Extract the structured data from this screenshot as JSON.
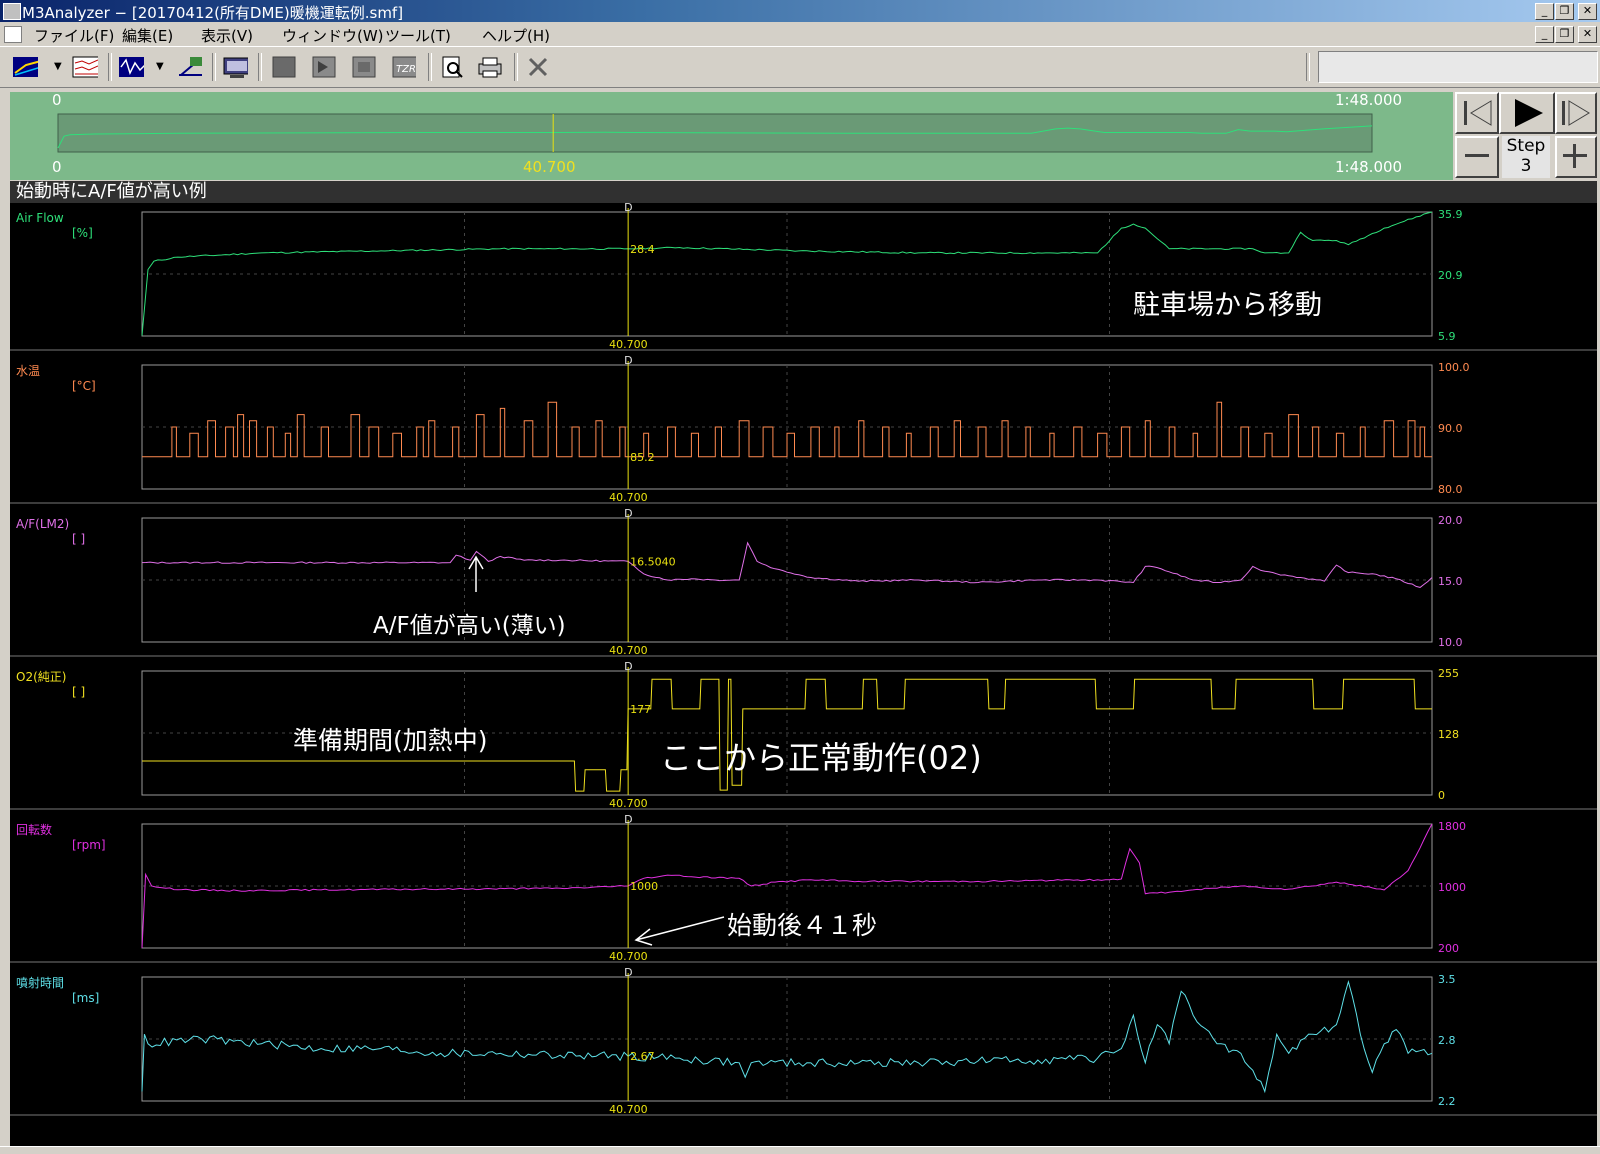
{
  "window": {
    "title": "M3Analyzer − [20170412(所有DME)暖機運転例.smf]"
  },
  "menu": [
    "ファイル(F)",
    "編集(E)",
    "表示(V)",
    "ウィンドウ(W)",
    "ツール(T)",
    "ヘルプ(H)"
  ],
  "overview": {
    "start": "0",
    "end": "1:48.000",
    "cursor": "40.700",
    "start_bottom": "0",
    "end_bottom": "1:48.000"
  },
  "controls": {
    "step_label": "Step",
    "step_value": "3"
  },
  "chart_window": {
    "title": "始動時にA/F値が高い例"
  },
  "chart_data": [
    {
      "type": "line",
      "name": "Air Flow",
      "unit": "[%]",
      "color": "#2ee07a",
      "ylim": [
        5.9,
        35.9
      ],
      "yticks": [
        "35.9",
        "20.9",
        "5.9"
      ],
      "cursor_value": "28.4",
      "cursor_time": "40.700",
      "x": [
        0,
        0.5,
        1,
        3,
        10,
        20,
        30,
        40.7,
        45,
        55,
        65,
        75,
        80,
        82,
        83,
        84,
        86,
        90,
        93,
        94,
        96,
        97,
        98,
        100,
        101,
        104,
        108
      ],
      "y": [
        6,
        22,
        24,
        25,
        26,
        26.5,
        27,
        27,
        27.3,
        26.5,
        26,
        26,
        26,
        32,
        33,
        32,
        27,
        27,
        27,
        26,
        26,
        31,
        29,
        29,
        28,
        32,
        36
      ]
    },
    {
      "type": "line",
      "name": "水温",
      "unit": "[°C]",
      "color": "#ff8a50",
      "ylim": [
        80.0,
        100.0
      ],
      "yticks": [
        "100.0",
        "90.0",
        "80.0"
      ],
      "cursor_value": "85.2",
      "cursor_time": "40.700",
      "base": 85.2,
      "spikes": [
        [
          2.5,
          90
        ],
        [
          4,
          89
        ],
        [
          5.5,
          91
        ],
        [
          7,
          90
        ],
        [
          8,
          92
        ],
        [
          9,
          91
        ],
        [
          10.5,
          90
        ],
        [
          12,
          89
        ],
        [
          13,
          92
        ],
        [
          15,
          90
        ],
        [
          17.5,
          92
        ],
        [
          19,
          90
        ],
        [
          21,
          89
        ],
        [
          23,
          90
        ],
        [
          24,
          91
        ],
        [
          26,
          90
        ],
        [
          28,
          92
        ],
        [
          30,
          93
        ],
        [
          32,
          91
        ],
        [
          34,
          94
        ],
        [
          36,
          90
        ],
        [
          38,
          91
        ],
        [
          40,
          90
        ],
        [
          42,
          89
        ],
        [
          44,
          90
        ],
        [
          46,
          89
        ],
        [
          48,
          90
        ],
        [
          50,
          91
        ],
        [
          52,
          90
        ],
        [
          54,
          89
        ],
        [
          56,
          90
        ],
        [
          58,
          90
        ],
        [
          60,
          91
        ],
        [
          62,
          90
        ],
        [
          64,
          89
        ],
        [
          66,
          90
        ],
        [
          68,
          91
        ],
        [
          70,
          90
        ],
        [
          72,
          91
        ],
        [
          74,
          90
        ],
        [
          76,
          89
        ],
        [
          78,
          90
        ],
        [
          80,
          89
        ],
        [
          82,
          90
        ],
        [
          84,
          91
        ],
        [
          86,
          90
        ],
        [
          88,
          89
        ],
        [
          90,
          94
        ],
        [
          92,
          90
        ],
        [
          94,
          89
        ],
        [
          96,
          92
        ],
        [
          98,
          90
        ],
        [
          100,
          89
        ],
        [
          102,
          90
        ],
        [
          104,
          91
        ],
        [
          106,
          91
        ],
        [
          107,
          90
        ]
      ]
    },
    {
      "type": "line",
      "name": "A/F(LM2)",
      "unit": "[ ]",
      "color": "#e070e8",
      "ylim": [
        10.0,
        20.0
      ],
      "yticks": [
        "20.0",
        "15.0",
        "10.0"
      ],
      "cursor_value": "16.5040",
      "cursor_time": "40.700",
      "x": [
        0,
        25.8,
        26.3,
        27.5,
        28,
        29,
        30,
        32,
        35,
        40.7,
        42,
        44,
        46,
        48,
        50,
        50.7,
        51.5,
        53,
        56,
        60,
        65,
        70,
        75,
        80,
        83,
        84,
        85,
        88,
        90,
        92,
        93,
        94,
        95,
        97,
        99,
        100,
        101,
        103,
        105,
        107,
        108
      ],
      "y": [
        16.4,
        16.4,
        17.0,
        16.6,
        17.3,
        16.5,
        16.9,
        16.6,
        16.6,
        16.5,
        15.5,
        15.0,
        15.1,
        15.0,
        15.0,
        18.0,
        16.5,
        15.9,
        15.2,
        14.9,
        15.0,
        14.8,
        15.0,
        15.0,
        14.8,
        16.1,
        16.0,
        15.0,
        14.8,
        15.0,
        16.1,
        15.7,
        15.5,
        15.2,
        14.9,
        16.2,
        15.6,
        15.5,
        15.1,
        14.4,
        15.2
      ]
    },
    {
      "type": "line",
      "name": "O2(純正)",
      "unit": "[ ]",
      "color": "#f0e020",
      "ylim": [
        0,
        255
      ],
      "yticks": [
        "255",
        "128",
        "0"
      ],
      "cursor_value": "177",
      "cursor_time": "40.700",
      "x": [
        0,
        36.2,
        36.3,
        37,
        37.1,
        38.8,
        38.9,
        40.0,
        40.1,
        40.6,
        40.7,
        42.6,
        42.7,
        44.3,
        44.4,
        46.7,
        46.8,
        48.3,
        48.4,
        49.0,
        49.1,
        49.3,
        49.4,
        50.2,
        50.3,
        55.5,
        55.6,
        57.2,
        57.3,
        60.3,
        60.4,
        61.5,
        61.6,
        63.8,
        63.9,
        70.8,
        70.9,
        72.2,
        72.3,
        79.8,
        79.9,
        83.0,
        83.1,
        89.5,
        89.6,
        91.5,
        91.6,
        98.0,
        98.1,
        100.5,
        100.6,
        106.5,
        106.6,
        108
      ],
      "y": [
        70,
        70,
        8,
        8,
        52,
        52,
        8,
        8,
        52,
        52,
        177,
        177,
        238,
        238,
        177,
        177,
        238,
        238,
        10,
        10,
        238,
        238,
        20,
        20,
        177,
        177,
        238,
        238,
        177,
        177,
        238,
        238,
        177,
        177,
        238,
        238,
        177,
        177,
        238,
        238,
        177,
        177,
        238,
        238,
        177,
        177,
        238,
        238,
        177,
        177,
        238,
        238,
        177,
        177,
        255,
        255
      ]
    },
    {
      "type": "line",
      "name": "回転数",
      "unit": "[rpm]",
      "color": "#e030e0",
      "ylim": [
        200,
        1800
      ],
      "yticks": [
        "1800",
        "1000",
        "200"
      ],
      "cursor_value": "1000",
      "cursor_time": "40.700",
      "x": [
        0,
        0.3,
        0.8,
        2,
        4,
        8,
        15,
        25,
        35,
        40.7,
        42,
        44,
        46,
        50,
        51,
        53,
        56,
        60,
        70,
        80,
        82,
        82.7,
        83.5,
        84,
        86,
        88,
        92,
        96,
        100,
        104,
        106,
        108
      ],
      "y": [
        200,
        1150,
        1000,
        970,
        950,
        940,
        950,
        960,
        970,
        1000,
        1100,
        1140,
        1120,
        1100,
        1000,
        1050,
        1080,
        1060,
        1060,
        1080,
        1090,
        1480,
        1300,
        900,
        920,
        950,
        1000,
        960,
        1050,
        950,
        1200,
        1800
      ]
    },
    {
      "type": "line",
      "name": "噴射時間",
      "unit": "[ms]",
      "color": "#5ee0e8",
      "ylim": [
        2.2,
        3.5
      ],
      "yticks": [
        "3.5",
        "2.8",
        "2.2"
      ],
      "cursor_value": "2.67",
      "cursor_time": "40.700",
      "x": [
        0,
        0.2,
        0.5,
        5,
        10,
        15,
        20,
        25,
        30,
        35,
        40.7,
        45,
        50,
        50.5,
        51,
        55,
        60,
        65,
        70,
        75,
        80,
        82,
        83,
        84,
        85,
        86,
        87,
        88,
        90,
        92,
        94,
        95,
        96,
        98,
        100,
        101,
        102,
        103,
        104,
        105,
        106,
        108
      ],
      "y": [
        2.3,
        2.9,
        2.8,
        2.85,
        2.8,
        2.75,
        2.75,
        2.7,
        2.7,
        2.68,
        2.67,
        2.65,
        2.6,
        2.45,
        2.6,
        2.6,
        2.6,
        2.6,
        2.62,
        2.63,
        2.65,
        2.75,
        3.1,
        2.6,
        3.0,
        2.8,
        3.35,
        3.1,
        2.8,
        2.7,
        2.3,
        2.9,
        2.7,
        2.9,
        3.0,
        3.45,
        2.9,
        2.5,
        2.8,
        2.95,
        2.7,
        2.7
      ]
    }
  ],
  "annotations": {
    "parking": "駐車場から移動",
    "af_high": "A/F値が高い(薄い)",
    "prep": "準備期間(加熱中)",
    "normal": "ここから正常動作(02)",
    "after_start": "始動後４１秒"
  },
  "cursor_mark": "D",
  "colors": {
    "grid": "#444444",
    "frame": "#9a9a9a",
    "cursor": "#e8e010",
    "tick_text": "#d0d0d0"
  }
}
